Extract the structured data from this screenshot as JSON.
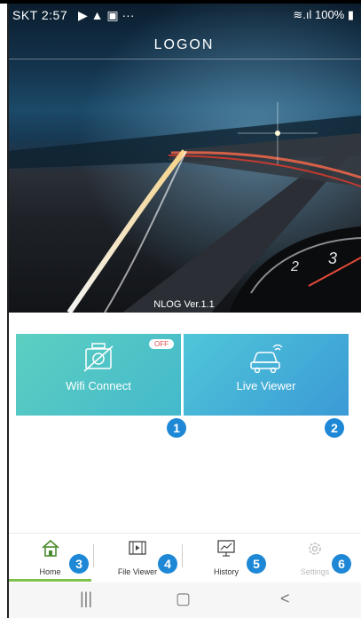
{
  "status_bar": {
    "carrier_time": "SKT 2:57",
    "battery": "100%"
  },
  "app": {
    "title": "LOGON",
    "version": "NLOG Ver.1.1"
  },
  "tiles": [
    {
      "label": "Wifi Connect",
      "badge": "OFF",
      "number": "1"
    },
    {
      "label": "Live Viewer",
      "number": "2"
    }
  ],
  "nav": [
    {
      "label": "Home",
      "number": "3"
    },
    {
      "label": "File Viewer",
      "number": "4"
    },
    {
      "label": "History",
      "number": "5"
    },
    {
      "label": "Settings",
      "number": "6"
    }
  ],
  "colors": {
    "accent": "#1e88d6",
    "home_underline": "#7cc24c",
    "tile_green": "#5ccfc0",
    "tile_blue": "#3b9ad6"
  }
}
